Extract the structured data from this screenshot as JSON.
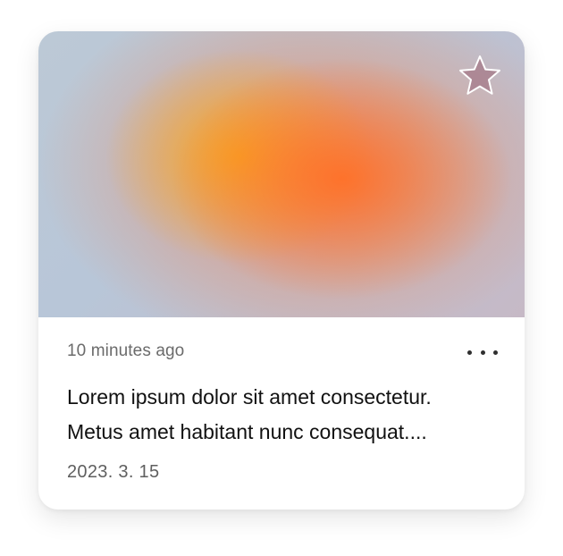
{
  "card": {
    "time_ago": "10 minutes ago",
    "description_lines": [
      "Lorem ipsum dolor sit amet consectetur.",
      "Metus amet habitant nunc consequat...."
    ],
    "date": "2023. 3. 15",
    "favorite_icon": "star-icon",
    "more_icon": "more-horizontal-icon",
    "colors": {
      "gradient_orange": "#ff7028",
      "gradient_yellow": "#f8aa1e",
      "gradient_blue": "#b8c6d8",
      "star_fill": "#a8808e"
    }
  }
}
